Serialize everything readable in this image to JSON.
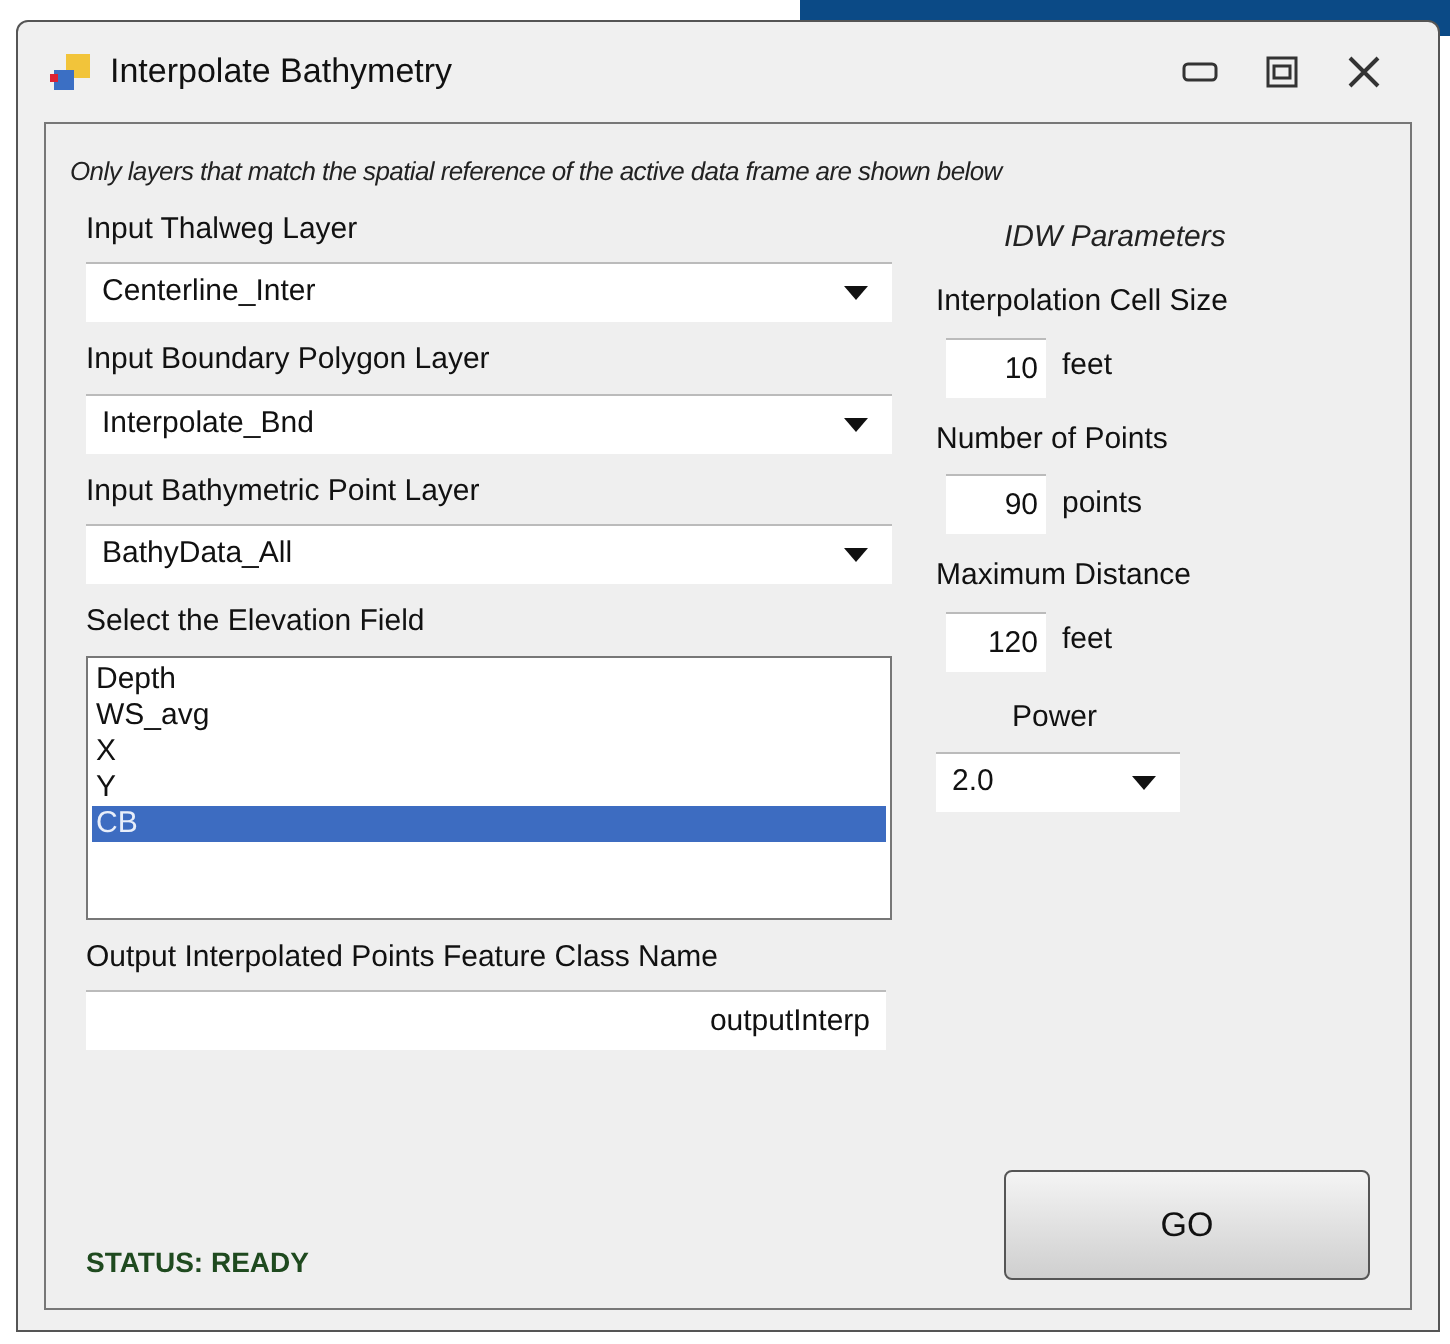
{
  "window": {
    "title": "Interpolate Bathymetry"
  },
  "notice": "Only layers that match the spatial reference of the active data frame are shown below",
  "left": [
    {
      "kind": "dropdown",
      "label": "Input Thalweg Layer",
      "value": "Centerline_Inter"
    },
    {
      "kind": "dropdown",
      "label": "Input Boundary Polygon Layer",
      "value": "Interpolate_Bnd"
    },
    {
      "kind": "dropdown",
      "label": "Input Bathymetric Point Layer",
      "value": "BathyData_All"
    }
  ],
  "elevation": {
    "label": "Select the Elevation Field",
    "items": [
      {
        "text": "Depth",
        "selected": false
      },
      {
        "text": "WS_avg",
        "selected": false
      },
      {
        "text": "X",
        "selected": false
      },
      {
        "text": "Y",
        "selected": false
      },
      {
        "text": "CB",
        "selected": true
      }
    ]
  },
  "output": {
    "label": "Output Interpolated Points Feature Class Name",
    "value": "outputInterp"
  },
  "status": "STATUS: READY",
  "idw": {
    "title": "IDW Parameters",
    "params": [
      {
        "label": "Interpolation Cell Size",
        "value": "10",
        "unit": "feet"
      },
      {
        "label": "Number of Points",
        "value": "90",
        "unit": "points"
      },
      {
        "label": "Maximum Distance",
        "value": "120",
        "unit": "feet"
      }
    ],
    "power": {
      "label": "Power",
      "value": "2.0"
    }
  },
  "go_button": "GO"
}
